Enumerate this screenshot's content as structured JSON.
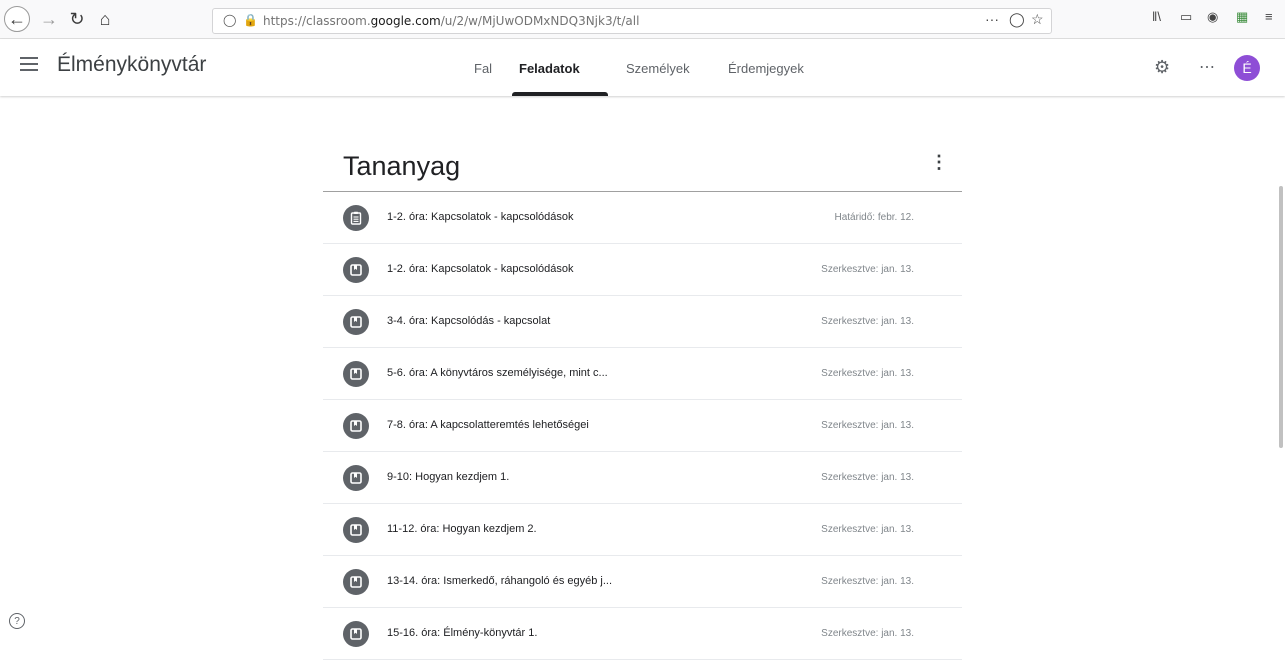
{
  "browser": {
    "url_prefix": "https://classroom.",
    "url_domain": "google.com",
    "url_path": "/u/2/w/MjUwODMxNDQ3Njk3/t/all",
    "more_label": "···"
  },
  "header": {
    "class_title": "Élménykönyvtár",
    "tabs": [
      {
        "label": "Fal"
      },
      {
        "label": "Feladatok"
      },
      {
        "label": "Személyek"
      },
      {
        "label": "Érdemjegyek"
      }
    ],
    "active_tab": "Feladatok",
    "avatar_letter": "É"
  },
  "topic": {
    "title": "Tananyag",
    "menu_glyph": "⋮",
    "items": [
      {
        "type": "assignment",
        "title": "1-2. óra: Kapcsolatok - kapcsolódások",
        "meta": "Határidő: febr. 12."
      },
      {
        "type": "material",
        "title": "1-2. óra: Kapcsolatok - kapcsolódások",
        "meta": "Szerkesztve: jan. 13."
      },
      {
        "type": "material",
        "title": "3-4. óra: Kapcsolódás - kapcsolat",
        "meta": "Szerkesztve: jan. 13."
      },
      {
        "type": "material",
        "title": "5-6. óra: A könyvtáros személyisége, mint c...",
        "meta": "Szerkesztve: jan. 13."
      },
      {
        "type": "material",
        "title": "7-8. óra: A kapcsolatteremtés lehetőségei",
        "meta": "Szerkesztve: jan. 13."
      },
      {
        "type": "material",
        "title": "9-10: Hogyan kezdjem 1.",
        "meta": "Szerkesztve: jan. 13."
      },
      {
        "type": "material",
        "title": "11-12. óra: Hogyan kezdjem 2.",
        "meta": "Szerkesztve: jan. 13."
      },
      {
        "type": "material",
        "title": "13-14. óra: Ismerkedő, ráhangoló és egyéb j...",
        "meta": "Szerkesztve: jan. 13."
      },
      {
        "type": "material",
        "title": "15-16. óra: Élmény-könyvtár 1.",
        "meta": "Szerkesztve: jan. 13."
      }
    ]
  },
  "help_glyph": "?"
}
